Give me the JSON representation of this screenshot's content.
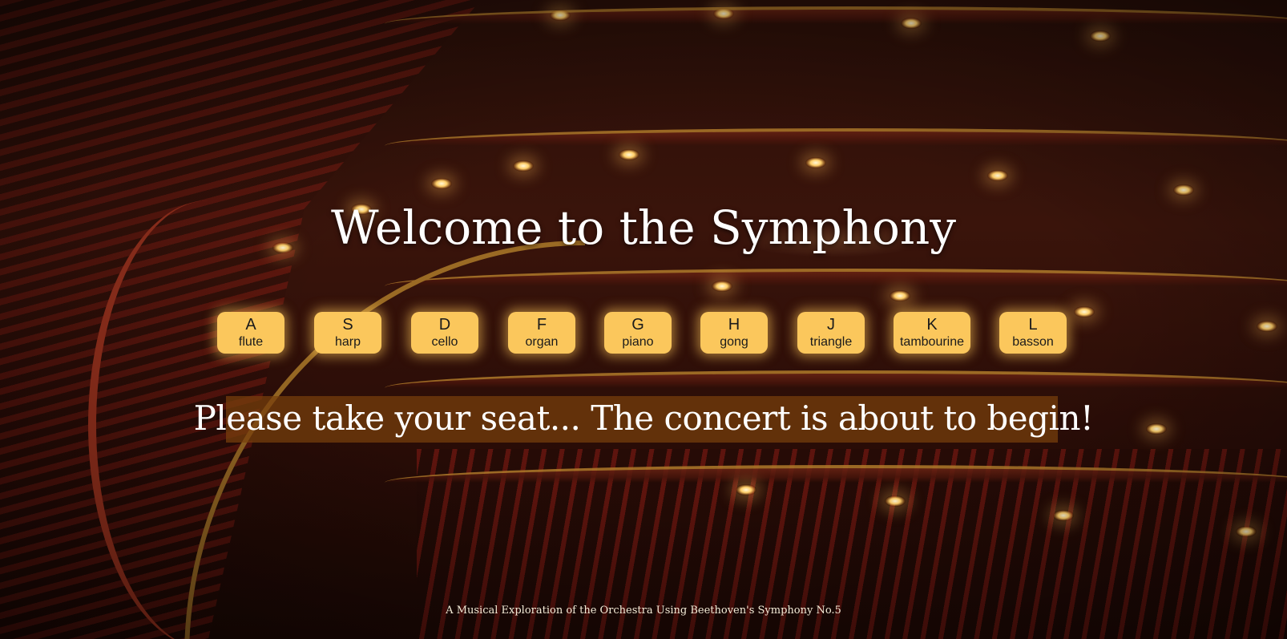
{
  "header": {
    "title": "Welcome to the Symphony"
  },
  "keys": [
    {
      "letter": "A",
      "instrument": "flute"
    },
    {
      "letter": "S",
      "instrument": "harp"
    },
    {
      "letter": "D",
      "instrument": "cello"
    },
    {
      "letter": "F",
      "instrument": "organ"
    },
    {
      "letter": "G",
      "instrument": "piano"
    },
    {
      "letter": "H",
      "instrument": "gong"
    },
    {
      "letter": "J",
      "instrument": "triangle"
    },
    {
      "letter": "K",
      "instrument": "tambourine"
    },
    {
      "letter": "L",
      "instrument": "basson"
    }
  ],
  "banner": {
    "message": "Please take your seat... The concert is about to begin!"
  },
  "footer": {
    "text": "A Musical Exploration of the Orchestra Using Beethoven's Symphony No.5"
  },
  "colors": {
    "key_background": "#fbc75c",
    "banner_background": "#78400c",
    "text": "#ffffff"
  }
}
